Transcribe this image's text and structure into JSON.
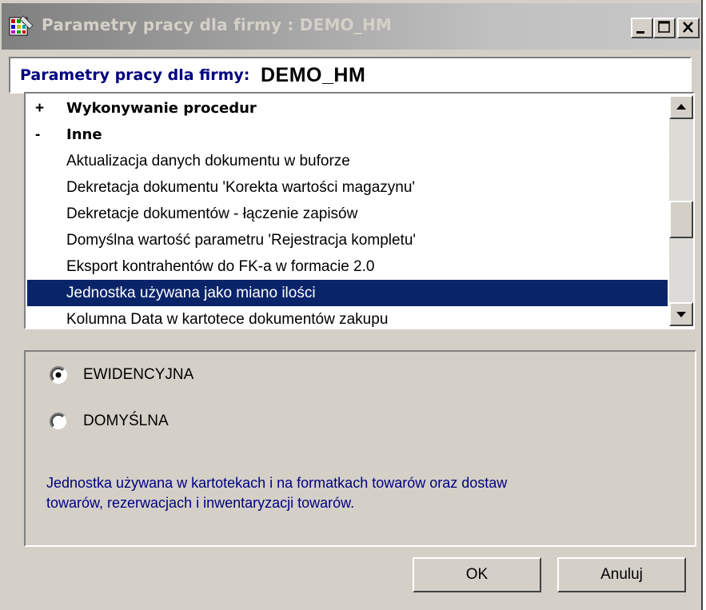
{
  "window": {
    "title": "Parametry pracy dla firmy : DEMO_HM",
    "icon": "app-grid-icon",
    "controls": [
      "minimize-icon",
      "maximize-icon",
      "close-icon"
    ]
  },
  "header": {
    "label": "Parametry pracy dla firmy:",
    "company": "DEMO_HM"
  },
  "list": {
    "items": [
      {
        "sign": "+",
        "text": "Wykonywanie procedur",
        "group": true
      },
      {
        "sign": "-",
        "text": "Inne",
        "group": true
      },
      {
        "sign": "",
        "text": "Aktualizacja danych dokumentu w buforze",
        "group": false
      },
      {
        "sign": "",
        "text": "Dekretacja dokumentu 'Korekta wartości magazynu'",
        "group": false
      },
      {
        "sign": "",
        "text": "Dekretacje dokumentów - łączenie zapisów",
        "group": false
      },
      {
        "sign": "",
        "text": "Domyślna wartość parametru 'Rejestracja kompletu'",
        "group": false
      },
      {
        "sign": "",
        "text": "Eksport kontrahentów do FK-a w formacie 2.0",
        "group": false
      },
      {
        "sign": "",
        "text": "Jednostka używana jako miano ilości",
        "group": false,
        "selected": true
      },
      {
        "sign": "",
        "text": "Kolumna Data w kartotece dokumentów zakupu",
        "group": false
      }
    ],
    "selected_color": "#0a246a"
  },
  "options": {
    "choices": [
      {
        "label": "EWIDENCYJNA",
        "checked": true
      },
      {
        "label": "DOMYŚLNA",
        "checked": false
      }
    ],
    "description_line1": "Jednostka używana w kartotekach i na formatkach towarów oraz dostaw",
    "description_line2": "towarów, rezerwacjach i inwentaryzacji towarów."
  },
  "buttons": {
    "ok": "OK",
    "cancel": "Anuluj"
  }
}
